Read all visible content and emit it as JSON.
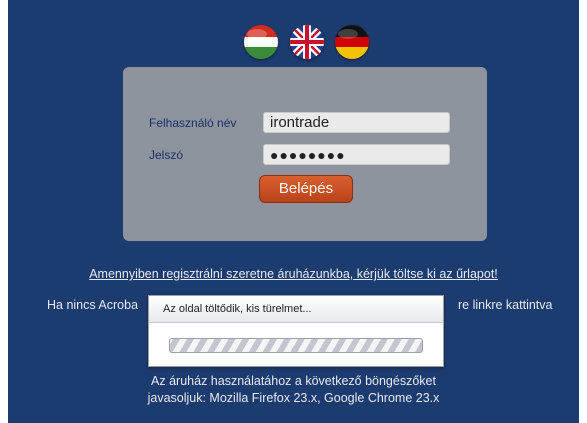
{
  "languages": [
    {
      "name": "hungarian-flag-icon",
      "colors": [
        "#d52b1e",
        "#ffffff",
        "#3a8a3a"
      ]
    },
    {
      "name": "uk-flag-icon",
      "colors": [
        "#1f3f8a",
        "#ffffff",
        "#c8102e"
      ]
    },
    {
      "name": "german-flag-icon",
      "colors": [
        "#111111",
        "#d00000",
        "#f2c200"
      ]
    }
  ],
  "login": {
    "username_label": "Felhasználó név",
    "username_value": "irontrade",
    "password_label": "Jelszó",
    "password_value": "●●●●●●●●",
    "submit_label": "Belépés"
  },
  "register_link": "Amennyiben regisztrálni szeretne áruházunkba, kérjük töltse ki az űrlapot!",
  "acrobat_notice": {
    "left": "Ha nincs Acroba",
    "right": "re linkre kattintva"
  },
  "browsers_notice": {
    "line1": "Az áruház használatához a következő böngészőket",
    "line2": "javasoljuk: Mozilla Firefox 23.x, Google Chrome 23.x"
  },
  "loading_dialog": {
    "title": "Az oldal töltődik, kis türelmet..."
  },
  "colors": {
    "background": "#1c3b6e",
    "login_box": "#8d949e",
    "button": "#c24a20"
  }
}
